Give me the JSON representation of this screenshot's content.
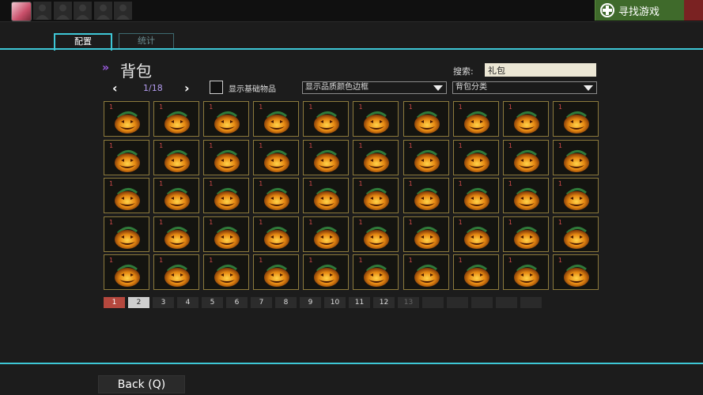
{
  "topbar": {
    "find_game_label": "寻找游戏",
    "friend_slots": 5
  },
  "tabs": [
    {
      "label": "配置",
      "active": true
    },
    {
      "label": "统计",
      "active": false
    }
  ],
  "header": {
    "title": "背包",
    "search_label": "搜索:",
    "search_value": "礼包"
  },
  "toolbar": {
    "page_indicator": "1/18",
    "show_basic_items_label": "显示基础物品",
    "show_basic_items_checked": false,
    "quality_border_select": "显示品质颜色边框",
    "category_select": "背包分类"
  },
  "inventory": {
    "item_icon": "jack-o-lantern-gift-icon",
    "item_quantity": "1",
    "rows": 5,
    "cols": 10,
    "border_color": "#8c7a3c"
  },
  "pagination": {
    "pages": [
      "1",
      "2",
      "3",
      "4",
      "5",
      "6",
      "7",
      "8",
      "9",
      "10",
      "11",
      "12",
      "13"
    ],
    "current": "1",
    "empty_slots": 5
  },
  "footer": {
    "back_label": "Back (Q)"
  },
  "colors": {
    "accent_cyan": "#3ec7d6",
    "find_game_green": "#3f6a2b",
    "current_page_red": "#b5483e",
    "page_count_purple": "#b49cf0"
  }
}
